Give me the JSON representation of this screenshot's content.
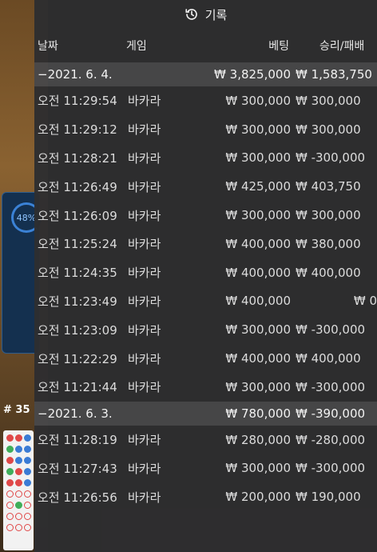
{
  "panel": {
    "title": "기록"
  },
  "columns": {
    "date": "날짜",
    "game": "게임",
    "bet": "베팅",
    "win": "승리/패배"
  },
  "background": {
    "gauge_percent": "48%",
    "round_label": "# 35"
  },
  "groups": [
    {
      "date": "−2021. 6. 4.",
      "total_bet": "₩ 3,825,000",
      "total_win": "₩ 1,583,750",
      "rows": [
        {
          "time": "오전 11:29:54",
          "game": "바카라",
          "bet": "₩ 300,000",
          "win": "₩ 300,000"
        },
        {
          "time": "오전 11:29:12",
          "game": "바카라",
          "bet": "₩ 300,000",
          "win": "₩ 300,000"
        },
        {
          "time": "오전 11:28:21",
          "game": "바카라",
          "bet": "₩ 300,000",
          "win": "₩ -300,000"
        },
        {
          "time": "오전 11:26:49",
          "game": "바카라",
          "bet": "₩ 425,000",
          "win": "₩ 403,750"
        },
        {
          "time": "오전 11:26:09",
          "game": "바카라",
          "bet": "₩ 300,000",
          "win": "₩ 300,000"
        },
        {
          "time": "오전 11:25:24",
          "game": "바카라",
          "bet": "₩ 400,000",
          "win": "₩ 380,000"
        },
        {
          "time": "오전 11:24:35",
          "game": "바카라",
          "bet": "₩ 400,000",
          "win": "₩ 400,000"
        },
        {
          "time": "오전 11:23:49",
          "game": "바카라",
          "bet": "₩ 400,000",
          "win": "₩ 0"
        },
        {
          "time": "오전 11:23:09",
          "game": "바카라",
          "bet": "₩ 300,000",
          "win": "₩ -300,000"
        },
        {
          "time": "오전 11:22:29",
          "game": "바카라",
          "bet": "₩ 400,000",
          "win": "₩ 400,000"
        },
        {
          "time": "오전 11:21:44",
          "game": "바카라",
          "bet": "₩ 300,000",
          "win": "₩ -300,000"
        }
      ]
    },
    {
      "date": "−2021. 6. 3.",
      "total_bet": "₩ 780,000",
      "total_win": "₩ -390,000",
      "rows": [
        {
          "time": "오전 11:28:19",
          "game": "바카라",
          "bet": "₩ 280,000",
          "win": "₩ -280,000"
        },
        {
          "time": "오전 11:27:43",
          "game": "바카라",
          "bet": "₩ 300,000",
          "win": "₩ -300,000"
        },
        {
          "time": "오전 11:26:56",
          "game": "바카라",
          "bet": "₩ 200,000",
          "win": "₩ 190,000"
        }
      ]
    }
  ]
}
